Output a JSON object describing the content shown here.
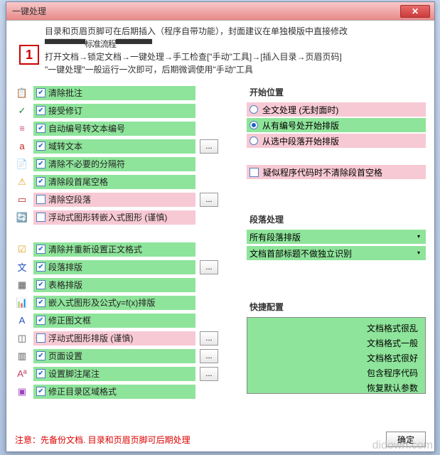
{
  "window": {
    "title": "一键处理"
  },
  "header": {
    "l1": "目录和页眉页脚可在后期插入（程序自带功能），封面建议在单独模版中直接修改",
    "l2": "▀▀▀▀▀▀▀▀▀标准流程▀▀▀▀▀▀▀▀",
    "l3": "打开文档→锁定文档→一键处理→手工检查[\"手动\"工具]→[插入目录→页眉页码]",
    "l4": "\"一键处理\"一般运行一次即可，后期微调使用\"手动\"工具",
    "icon": "1"
  },
  "leftItems": [
    {
      "icon": "📋",
      "iconColor": "#d08030",
      "label": "清除批注",
      "checked": true,
      "color": "green",
      "btn": false
    },
    {
      "icon": "✓",
      "iconColor": "#208830",
      "label": "接受修订",
      "checked": true,
      "color": "green",
      "btn": false
    },
    {
      "icon": "≡",
      "iconColor": "#d05080",
      "label": "自动编号转文本编号",
      "checked": true,
      "color": "green",
      "btn": false
    },
    {
      "icon": "a",
      "iconColor": "#c02020",
      "label": "域转文本",
      "checked": true,
      "color": "green",
      "btn": true
    },
    {
      "icon": "📄",
      "iconColor": "#333",
      "label": "清除不必要的分隔符",
      "checked": true,
      "color": "green",
      "btn": false
    },
    {
      "icon": "⚠",
      "iconColor": "#e0a020",
      "label": "清除段首尾空格",
      "checked": true,
      "color": "green",
      "btn": false
    },
    {
      "icon": "▭",
      "iconColor": "#c02020",
      "label": "清除空段落",
      "checked": false,
      "color": "pink",
      "btn": true
    },
    {
      "icon": "🔄",
      "iconColor": "#3060c0",
      "label": "浮动式图形转嵌入式图形 (谨慎)",
      "checked": false,
      "color": "pink",
      "btn": false
    },
    {
      "gap": true
    },
    {
      "icon": "☑",
      "iconColor": "#e0a020",
      "label": "清除并重新设置正文格式",
      "checked": true,
      "color": "green",
      "btn": false
    },
    {
      "icon": "文",
      "iconColor": "#2050c0",
      "label": "段落排版",
      "checked": true,
      "color": "green",
      "btn": true
    },
    {
      "icon": "▦",
      "iconColor": "#555",
      "label": "表格排版",
      "checked": true,
      "color": "green",
      "btn": false
    },
    {
      "icon": "📊",
      "iconColor": "#d07030",
      "label": "嵌入式图形及公式y=f(x)排版",
      "checked": true,
      "color": "green",
      "btn": false
    },
    {
      "icon": "A",
      "iconColor": "#2050c0",
      "label": "修正图文框",
      "checked": true,
      "color": "green",
      "btn": false
    },
    {
      "icon": "◫",
      "iconColor": "#555",
      "label": "浮动式图形排版 (谨慎)",
      "checked": false,
      "color": "pink",
      "btn": true
    },
    {
      "icon": "▥",
      "iconColor": "#555",
      "label": "页面设置",
      "checked": true,
      "color": "green",
      "btn": true
    },
    {
      "icon": "Aª",
      "iconColor": "#c04060",
      "label": "设置脚注尾注",
      "checked": true,
      "color": "green",
      "btn": true
    },
    {
      "icon": "▣",
      "iconColor": "#a040c0",
      "label": "修正目录区域格式",
      "checked": true,
      "color": "green",
      "btn": false
    }
  ],
  "right": {
    "startTitle": "开始位置",
    "startOpts": [
      {
        "label": "全文处理 (无封面时)",
        "checked": false,
        "color": "pink"
      },
      {
        "label": "从有编号处开始排版",
        "checked": true,
        "color": "green"
      },
      {
        "label": "从选中段落开始排版",
        "checked": false,
        "color": "pink"
      }
    ],
    "suspect": {
      "label": "疑似程序代码时不清除段首空格",
      "checked": false
    },
    "paraTitle": "段落处理",
    "paraDrops": [
      "所有段落排版",
      "文档首部标题不做独立识别"
    ],
    "quickTitle": "快捷配置",
    "quickItems": [
      "文档格式很乱",
      "文档格式一般",
      "文档格式很好",
      "包含程序代码",
      "恢复默认参数"
    ]
  },
  "footer": {
    "warning": "注意：先备份文档. 目录和页眉页脚可后期处理",
    "ok": "确定"
  },
  "ellipsis": "...",
  "watermark": "didown.com"
}
